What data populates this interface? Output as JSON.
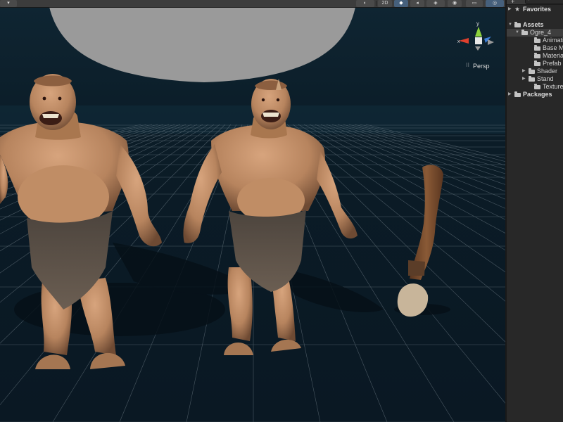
{
  "toolbar": {
    "dropdown_label": "▾",
    "mode_2d": "2D",
    "buttons": [
      "◐",
      "2D",
      "💡",
      "🔊",
      "◈",
      "👁",
      "▭",
      "🌐"
    ]
  },
  "gizmo": {
    "y_label": "y",
    "x_label": "x",
    "projection_label": "Persp",
    "projection_icon": "⁝⁝"
  },
  "project": {
    "add_label": "+",
    "search_icon": "⌕",
    "tree": [
      {
        "label": "Favorites",
        "kind": "star",
        "expanded": false
      },
      {
        "label": "Assets",
        "kind": "folder",
        "expanded": true
      },
      {
        "label": "Ogre_4",
        "kind": "folder",
        "expanded": true,
        "selected": true
      },
      {
        "label": "Animation",
        "kind": "folder"
      },
      {
        "label": "Base Mesh",
        "kind": "folder"
      },
      {
        "label": "Materials",
        "kind": "folder"
      },
      {
        "label": "Prefab",
        "kind": "folder"
      },
      {
        "label": "Shader",
        "kind": "folder",
        "expanded": false
      },
      {
        "label": "Stand",
        "kind": "folder",
        "expanded": false
      },
      {
        "label": "Texture",
        "kind": "folder"
      },
      {
        "label": "Packages",
        "kind": "folder",
        "expanded": false
      }
    ]
  },
  "colors": {
    "axis_x": "#e0402d",
    "axis_y": "#8dd13b",
    "axis_z": "#3d7fd9",
    "skin": "#b98660",
    "loincloth": "#5a4f45"
  }
}
